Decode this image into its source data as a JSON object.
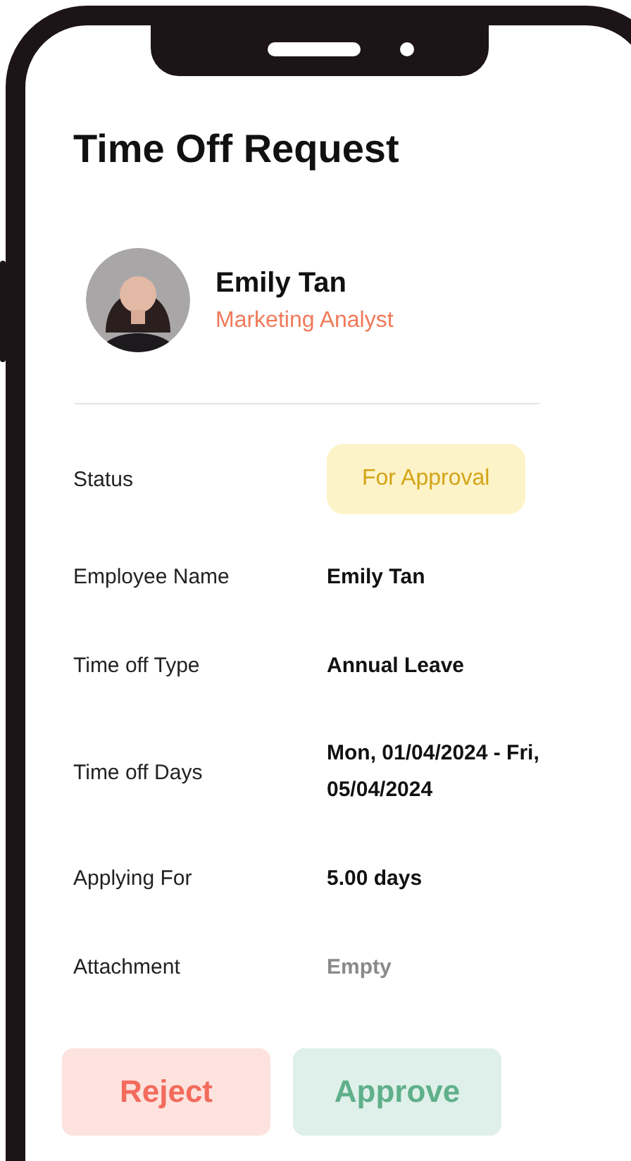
{
  "title": "Time Off Request",
  "employee": {
    "name": "Emily Tan",
    "role": "Marketing Analyst"
  },
  "details": [
    {
      "label": "Status",
      "value": "For Approval",
      "kind": "status"
    },
    {
      "label": "Employee Name",
      "value": "Emily Tan",
      "kind": "text"
    },
    {
      "label": "Time off Type",
      "value": "Annual Leave",
      "kind": "text"
    },
    {
      "label": "Time off Days",
      "value": "Mon, 01/04/2024 - Fri, 05/04/2024",
      "kind": "text"
    },
    {
      "label": "Applying For",
      "value": "5.00 days",
      "kind": "text"
    },
    {
      "label": "Attachment",
      "value": "Empty",
      "kind": "empty"
    }
  ],
  "buttons": [
    {
      "label": "Reject",
      "kind": "reject"
    },
    {
      "label": "Approve",
      "kind": "approve"
    }
  ]
}
